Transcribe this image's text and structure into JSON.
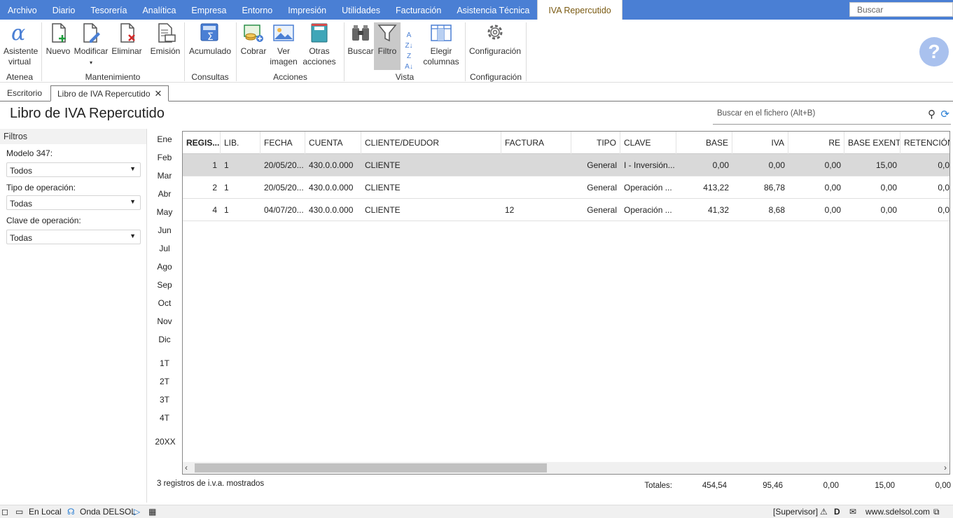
{
  "menu": [
    "Archivo",
    "Diario",
    "Tesorería",
    "Analítica",
    "Empresa",
    "Entorno",
    "Impresión",
    "Utilidades",
    "Facturación",
    "Asistencia Técnica",
    "IVA Repercutido"
  ],
  "top_search_placeholder": "Buscar",
  "ribbon": {
    "asistente": "Asistente virtual",
    "nuevo": "Nuevo",
    "modificar": "Modificar",
    "eliminar": "Eliminar",
    "emision": "Emisión",
    "acumulado": "Acumulado",
    "cobrar": "Cobrar",
    "ver_imagen": "Ver imagen",
    "otras_acciones": "Otras acciones",
    "buscar": "Buscar",
    "filtro": "Filtro",
    "elegir_columnas": "Elegir columnas",
    "configuracion": "Configuración",
    "groups": {
      "atenea": "Atenea",
      "mantenimiento": "Mantenimiento",
      "consultas": "Consultas",
      "acciones": "Acciones",
      "vista": "Vista",
      "configuracion": "Configuración"
    }
  },
  "tabs": {
    "escritorio": "Escritorio",
    "libro": "Libro de IVA Repercutido"
  },
  "page_title": "Libro de IVA Repercutido",
  "file_search_placeholder": "Buscar en el fichero (Alt+B)",
  "filters": {
    "title": "Filtros",
    "modelo_label": "Modelo 347:",
    "modelo_value": "Todos",
    "tipo_label": "Tipo de operación:",
    "tipo_value": "Todas",
    "clave_label": "Clave de operación:",
    "clave_value": "Todas"
  },
  "months": [
    "Ene",
    "Feb",
    "Mar",
    "Abr",
    "May",
    "Jun",
    "Jul",
    "Ago",
    "Sep",
    "Oct",
    "Nov",
    "Dic"
  ],
  "quarters": [
    "1T",
    "2T",
    "3T",
    "4T"
  ],
  "year": "20XX",
  "table": {
    "columns": [
      "REGIS...",
      "LIB.",
      "FECHA",
      "CUENTA",
      "CLIENTE/DEUDOR",
      "FACTURA",
      "TIPO",
      "CLAVE",
      "BASE",
      "IVA",
      "RE",
      "BASE EXENTA",
      "RETENCIÓN"
    ],
    "rows": [
      [
        "1",
        "1",
        "20/05/20...",
        "430.0.0.000",
        "CLIENTE",
        "",
        "General",
        "I - Inversión...",
        "0,00",
        "0,00",
        "0,00",
        "15,00",
        "0,0"
      ],
      [
        "2",
        "1",
        "20/05/20...",
        "430.0.0.000",
        "CLIENTE",
        "",
        "General",
        "Operación ...",
        "413,22",
        "86,78",
        "0,00",
        "0,00",
        "0,0"
      ],
      [
        "4",
        "1",
        "04/07/20...",
        "430.0.0.000",
        "CLIENTE",
        "12",
        "General",
        "Operación ...",
        "41,32",
        "8,68",
        "0,00",
        "0,00",
        "0,0"
      ]
    ]
  },
  "records_count": "3 registros de i.v.a. mostrados",
  "totals": {
    "label": "Totales:",
    "base": "454,54",
    "iva": "95,46",
    "re": "0,00",
    "exenta": "15,00",
    "retencion": "0,00"
  },
  "status": {
    "local": "En Local",
    "onda": "Onda DELSOL",
    "supervisor": "[Supervisor]",
    "web": "www.sdelsol.com"
  }
}
